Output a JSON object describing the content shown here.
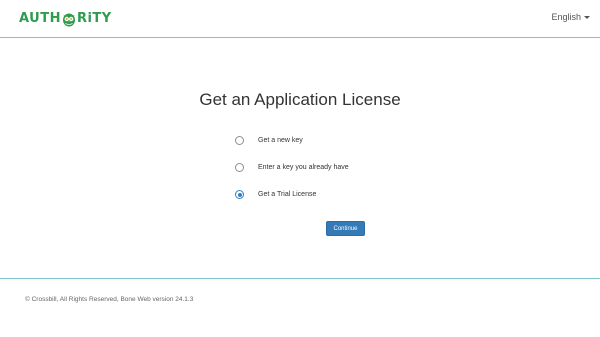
{
  "header": {
    "logo": {
      "text_before": "AUTH",
      "text_after": "RiTY",
      "mark_icon": "owl-icon",
      "color": "#2e9c4e"
    },
    "language": {
      "label": "English",
      "icon": "caret-down-icon"
    },
    "divider_color": "#7fc3cf"
  },
  "main": {
    "title": "Get an Application License",
    "options": [
      {
        "label": "Get a new key",
        "checked": false
      },
      {
        "label": "Enter a key you already have",
        "checked": false
      },
      {
        "label": "Get a Trial License",
        "checked": true
      }
    ],
    "continue_label": "Continue",
    "accent_color": "#337ab7"
  },
  "footer": {
    "text": "© Crossbill, All Rights Reserved, Bone Web version 24.1.3"
  }
}
